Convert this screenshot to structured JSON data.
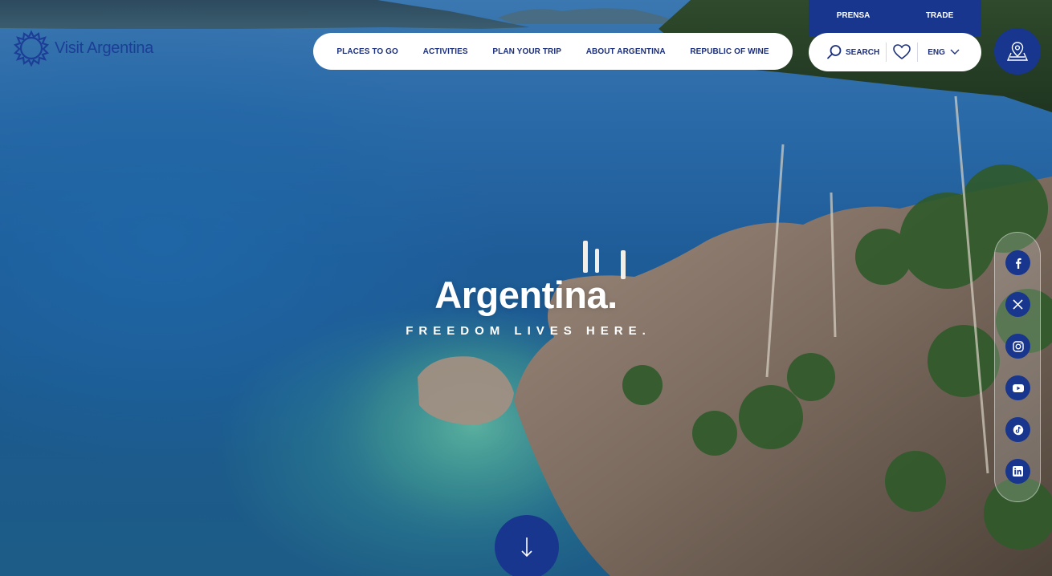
{
  "brand": {
    "name": "Visit Argentina",
    "accent": "#18368d",
    "text_color": "#1c2f7a"
  },
  "nav": {
    "items": [
      "PLACES TO GO",
      "ACTIVITIES",
      "PLAN YOUR TRIP",
      "ABOUT ARGENTINA",
      "REPUBLIC OF WINE"
    ]
  },
  "top_links": {
    "press": "PRENSA",
    "trade": "TRADE"
  },
  "utility": {
    "search_label": "SEARCH",
    "language": "ENG",
    "favorites_icon": "heart-icon",
    "search_icon": "search-icon"
  },
  "map_button": {
    "icon": "map-pin-icon"
  },
  "hero": {
    "title": "Argentina.",
    "tagline": "FREEDOM LIVES HERE."
  },
  "social": [
    "facebook-icon",
    "x-icon",
    "instagram-icon",
    "youtube-icon",
    "tiktok-icon",
    "linkedin-icon"
  ],
  "scroll": {
    "icon": "arrow-down-icon"
  }
}
